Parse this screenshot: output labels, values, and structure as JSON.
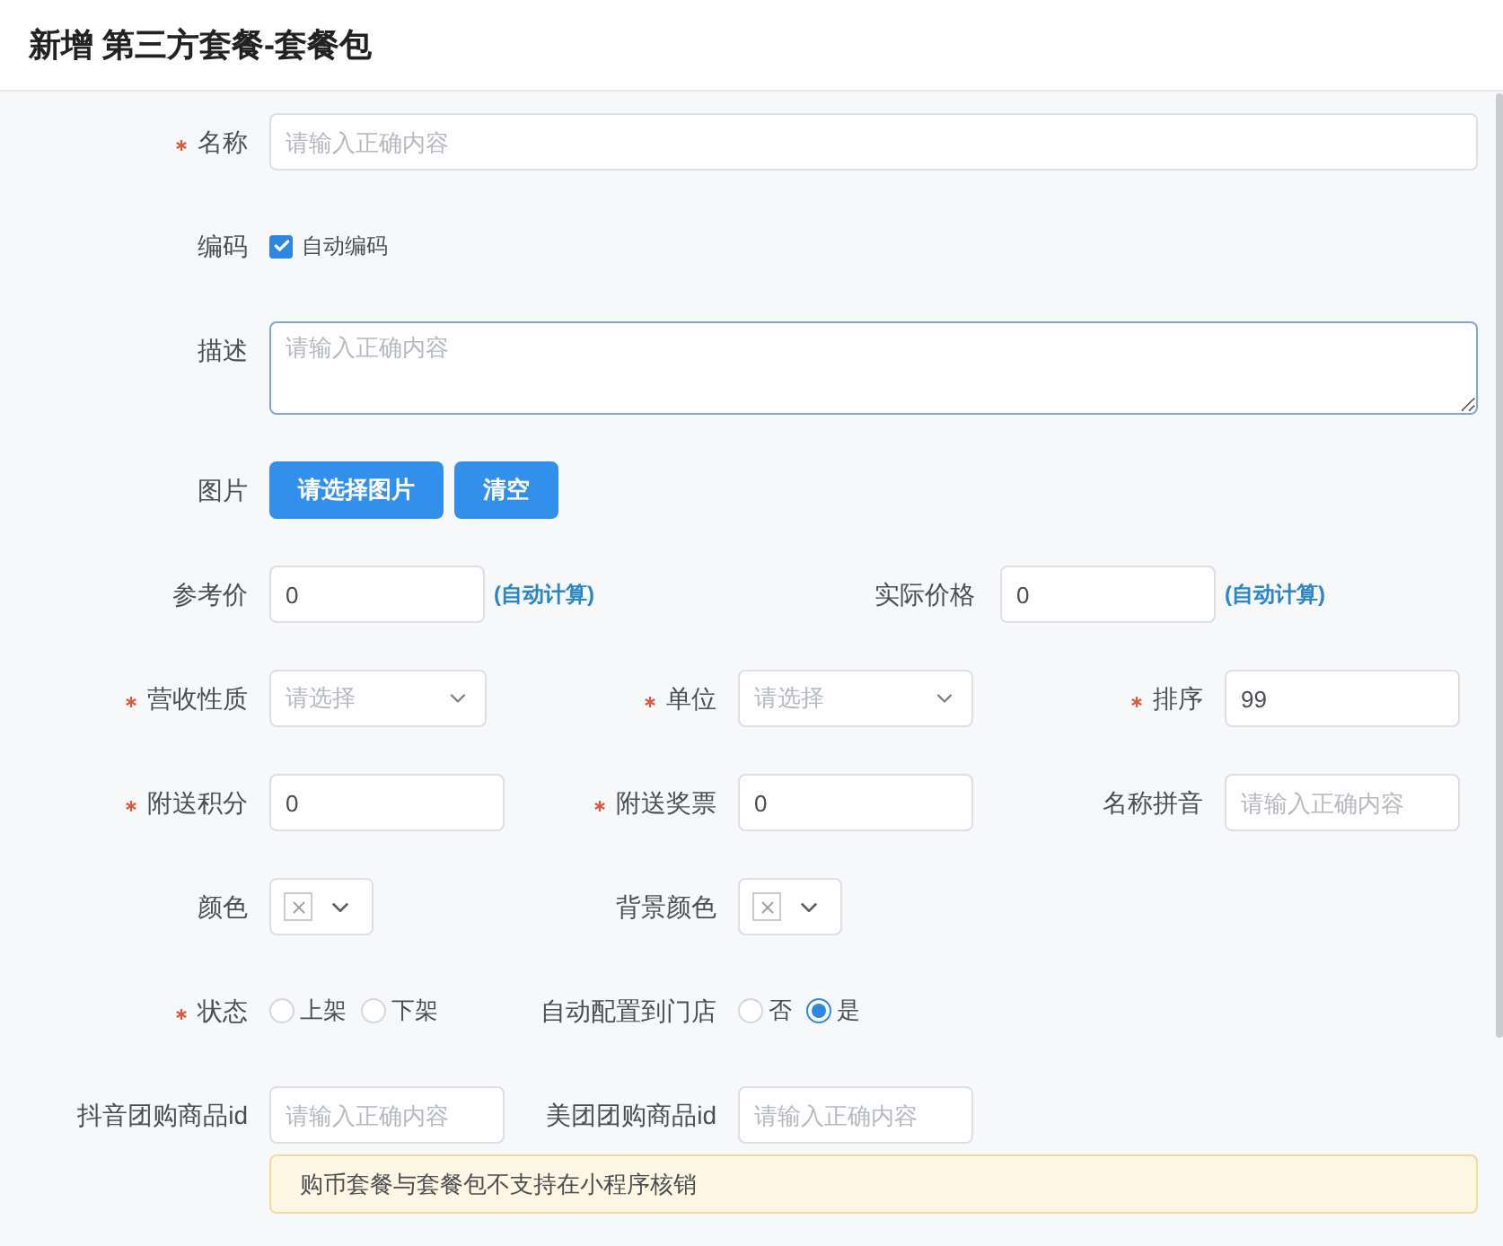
{
  "title": "新增 第三方套餐-套餐包",
  "rows": [
    {
      "cells": [
        {
          "kind": "text",
          "label": "名称",
          "required": true,
          "placeholder": "请输入正确内容"
        }
      ]
    },
    {
      "cells": [
        {
          "kind": "checkbox",
          "label": "编码",
          "required": false,
          "option": "自动编码",
          "checked": true
        }
      ]
    },
    {
      "cells": [
        {
          "kind": "textarea",
          "label": "描述",
          "required": false,
          "placeholder": "请输入正确内容"
        }
      ]
    },
    {
      "cells": [
        {
          "kind": "buttons",
          "label": "图片",
          "required": false,
          "buttons": [
            "请选择图片",
            "清空"
          ]
        }
      ]
    },
    {
      "cells": [
        {
          "kind": "computed",
          "label": "参考价",
          "required": false,
          "value": "0",
          "note": "(自动计算)"
        },
        {
          "kind": "computed",
          "label": "实际价格",
          "required": false,
          "value": "0",
          "note": "(自动计算)"
        }
      ]
    },
    {
      "cells": [
        {
          "kind": "select",
          "label": "营收性质",
          "required": true,
          "placeholder": "请选择"
        },
        {
          "kind": "select",
          "label": "单位",
          "required": true,
          "placeholder": "请选择"
        },
        {
          "kind": "text",
          "label": "排序",
          "required": true,
          "value": "99"
        }
      ]
    },
    {
      "cells": [
        {
          "kind": "text",
          "label": "附送积分",
          "required": true,
          "value": "0"
        },
        {
          "kind": "text",
          "label": "附送奖票",
          "required": true,
          "value": "0"
        },
        {
          "kind": "text",
          "label": "名称拼音",
          "required": false,
          "placeholder": "请输入正确内容"
        }
      ]
    },
    {
      "cells": [
        {
          "kind": "color",
          "label": "颜色",
          "required": false
        },
        {
          "kind": "color",
          "label": "背景颜色",
          "required": false
        }
      ]
    },
    {
      "cells": [
        {
          "kind": "radio",
          "label": "状态",
          "required": true,
          "options": [
            {
              "label": "上架",
              "selected": false
            },
            {
              "label": "下架",
              "selected": false
            }
          ]
        },
        {
          "kind": "radio",
          "label": "自动配置到门店",
          "required": false,
          "options": [
            {
              "label": "否",
              "selected": false
            },
            {
              "label": "是",
              "selected": true
            }
          ]
        }
      ]
    },
    {
      "cells": [
        {
          "kind": "text",
          "label": "抖音团购商品id",
          "required": false,
          "placeholder": "请输入正确内容"
        },
        {
          "kind": "text",
          "label": "美团团购商品id",
          "required": false,
          "placeholder": "请输入正确内容"
        }
      ]
    }
  ],
  "notice": "购币套餐与套餐包不支持在小程序核销"
}
